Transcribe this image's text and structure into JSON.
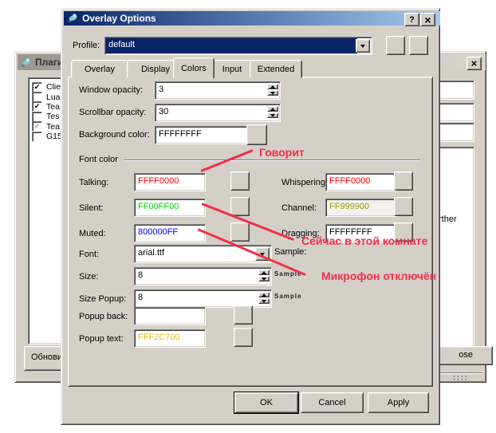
{
  "icons": {
    "help_glyph": "?",
    "close_glyph": "×",
    "dropdown_icon": "combo-arrow",
    "check_glyph": "✔"
  },
  "colors": {
    "annotation_red": "#f2304b",
    "titlebar_gradient_start": "#0a246a",
    "titlebar_gradient_end": "#a6caf0",
    "window_face": "#d4d0c8"
  },
  "dialog": {
    "title": "Overlay Options",
    "profile_label": "Profile:",
    "profile_value": "default",
    "tabs": [
      {
        "label": "Overlay"
      },
      {
        "label": "Display"
      },
      {
        "label": "Colors"
      },
      {
        "label": "Input"
      },
      {
        "label": "Extended"
      }
    ],
    "fields": {
      "window_opacity": {
        "label": "Window opacity:",
        "value": "3"
      },
      "scrollbar_opacity": {
        "label": "Scrollbar opacity:",
        "value": "30"
      },
      "background_color": {
        "label": "Background color:",
        "value": "FFFFFFFF",
        "color": "#000000"
      },
      "font_color_group": "Font color",
      "talking": {
        "label": "Talking:",
        "value": "FFFF0000",
        "color": "#ff0000"
      },
      "silent": {
        "label": "Silent:",
        "value": "FF00FF00",
        "color": "#00cf00"
      },
      "muted": {
        "label": "Muted:",
        "value": "800000FF",
        "color": "#0000ff"
      },
      "whispering": {
        "label": "Whispering:",
        "value": "FFFF0000",
        "color": "#ff0000"
      },
      "channel": {
        "label": "Channel:",
        "value": "FF999900",
        "color": "#9a9a00"
      },
      "dragging": {
        "label": "Dragging:",
        "value": "FFFFFFFF",
        "color": "#000000"
      },
      "font": {
        "label": "Font:",
        "value": "arial.ttf"
      },
      "sample_label": "Sample:",
      "size": {
        "label": "Size:",
        "value": "8",
        "sample": "Sample"
      },
      "size_popup": {
        "label": "Size Popup:",
        "value": "8",
        "sample": "Sample"
      },
      "popup_back": {
        "label": "Popup back:",
        "value": ""
      },
      "popup_text": {
        "label": "Popup text:",
        "value": "FFF2C700",
        "color": "#e8bd00"
      }
    },
    "buttons": {
      "ok": "OK",
      "cancel": "Cancel",
      "apply": "Apply"
    }
  },
  "background_window": {
    "title": "Плаги",
    "plugins": [
      {
        "label": "Clie",
        "check": "✔"
      },
      {
        "label": "Lua",
        "check": ""
      },
      {
        "label": "Tea",
        "check": "✔"
      },
      {
        "label": "Tes",
        "check": ""
      },
      {
        "label": "Tea",
        "check": "✔"
      },
      {
        "label": "G15",
        "check": ""
      }
    ],
    "update_button_fragment": "Обнови",
    "close_button_fragment": "ose",
    "text_fragment": "rther"
  },
  "annotations": {
    "color": "#f2304b",
    "talking_note": "Говорит",
    "room_note": "Сейчас в этой комнате",
    "mic_note": "Микрофон отключён"
  }
}
